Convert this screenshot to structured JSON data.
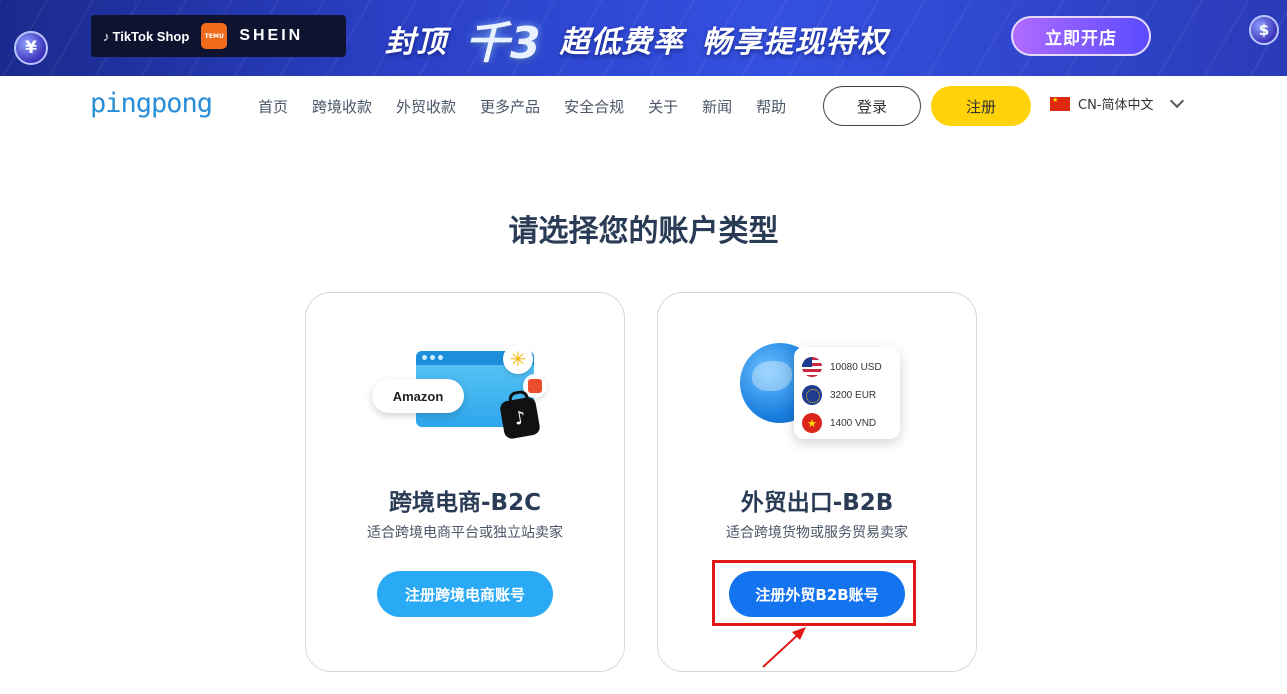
{
  "banner": {
    "left_coin": "¥",
    "right_coin": "$",
    "brands": {
      "tiktok": "TikTok Shop",
      "temu": "TEMU",
      "shein": "SHEIN"
    },
    "headline_part1": "封顶",
    "headline_big": "千3",
    "headline_part2": "超低费率",
    "headline_part3": "畅享提现特权",
    "cta_label": "立即开店",
    "colors": {
      "bg": "#2a3fc4",
      "cta": "#8a5cff"
    }
  },
  "navbar": {
    "logo": "pingpong",
    "links": [
      "首页",
      "跨境收款",
      "外贸收款",
      "更多产品",
      "安全合规",
      "关于",
      "新闻",
      "帮助"
    ],
    "login_label": "登录",
    "signup_label": "注册",
    "language": "CN-简体中文",
    "colors": {
      "signup": "#ffd20a",
      "logo": "#2a8ed8"
    }
  },
  "page_title": "请选择您的账户类型",
  "cards": {
    "b2c": {
      "title": "跨境电商-B2C",
      "subtitle": "适合跨境电商平台或独立站卖家",
      "button_label": "注册跨境电商账号",
      "illustration": {
        "amazon_label": "Amazon",
        "icons": [
          "walmart-icon",
          "shopee-icon",
          "tiktok-bag-icon"
        ]
      },
      "button_color": "#2aaaf5"
    },
    "b2b": {
      "title": "外贸出口-B2B",
      "subtitle": "适合跨境货物或服务贸易卖家",
      "button_label": "注册外贸B2B账号",
      "illustration": {
        "currencies": [
          {
            "flag": "us-flag-icon",
            "label": "10080 USD"
          },
          {
            "flag": "eu-flag-icon",
            "label": "3200 EUR"
          },
          {
            "flag": "vn-flag-icon",
            "label": "1400 VND"
          }
        ]
      },
      "button_color": "#1474f0"
    }
  },
  "annotation": {
    "highlight_color": "#e01818"
  }
}
